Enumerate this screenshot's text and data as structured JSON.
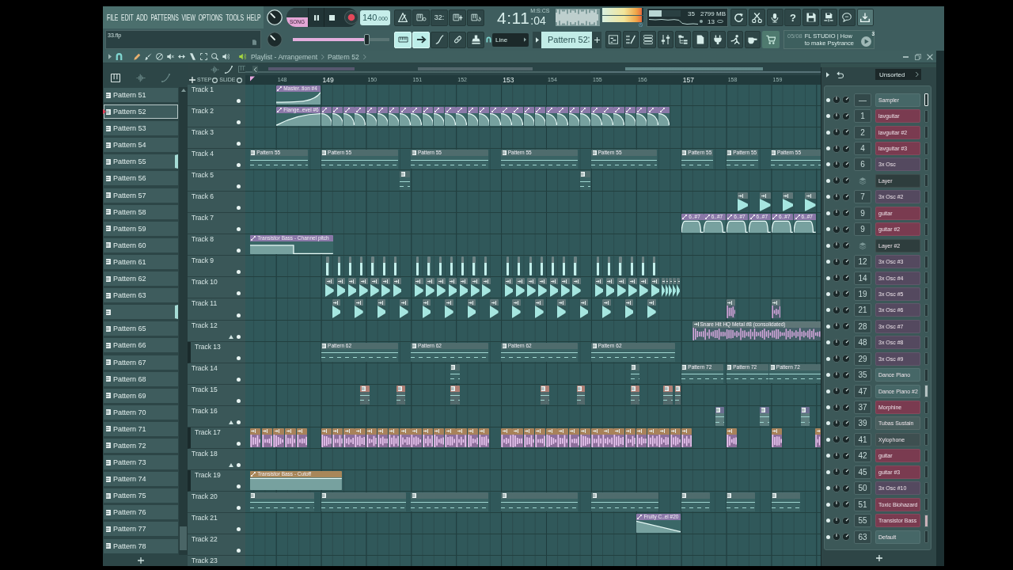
{
  "toolbar": {
    "menu": [
      "FILE",
      "EDIT",
      "ADD",
      "PATTERNS",
      "VIEW",
      "OPTIONS",
      "TOOLS",
      "HELP"
    ],
    "mode": {
      "label": "SONG",
      "selected": true
    },
    "tempo": "140",
    "tempo_decimals": ".000",
    "countdown_label": "32:",
    "time": "4:11",
    "time_hundredths": ":04",
    "time_format": "M:S:CS",
    "meters": [
      {
        "level": 0.97
      },
      {
        "level": 0.97
      }
    ],
    "cpu": {
      "level": 0.4,
      "reading": "35"
    },
    "memory": "2799 MB",
    "polyphony": "13",
    "help_label": "?",
    "hint": "33.flp",
    "song_position": {
      "level": 0.76
    },
    "record_toggles": [
      {
        "on": true
      },
      {
        "on": true
      },
      {
        "on": false
      },
      {
        "on": false
      },
      {
        "on": false
      }
    ],
    "snap": "Line",
    "pattern": "Pattern 52",
    "news": {
      "date": "05/08",
      "headline": "FL STUDIO | How to make Psytrance",
      "badge": "3"
    }
  },
  "playlist": {
    "title": "Playlist - Arrangement",
    "breadcrumb": "Pattern 52",
    "step_label": "STEP",
    "slide_label": "SLIDE",
    "patterns": [
      {
        "label": "Pattern 51",
        "selected": false,
        "marked": false
      },
      {
        "label": "Pattern 52",
        "selected": true,
        "marked": false
      },
      {
        "label": "Pattern 53",
        "selected": false,
        "marked": false
      },
      {
        "label": "Pattern 54",
        "selected": false,
        "marked": false
      },
      {
        "label": "Pattern 55",
        "selected": false,
        "marked": true
      },
      {
        "label": "Pattern 56",
        "selected": false,
        "marked": false
      },
      {
        "label": "Pattern 57",
        "selected": false,
        "marked": false
      },
      {
        "label": "Pattern 58",
        "selected": false,
        "marked": false
      },
      {
        "label": "Pattern 59",
        "selected": false,
        "marked": false
      },
      {
        "label": "Pattern 60",
        "selected": false,
        "marked": false
      },
      {
        "label": "Pattern 61",
        "selected": false,
        "marked": false
      },
      {
        "label": "Pattern 62",
        "selected": false,
        "marked": false
      },
      {
        "label": "Pattern 63",
        "selected": false,
        "marked": false
      },
      {
        "selected": false,
        "marked": true
      },
      {
        "label": "Pattern 65",
        "selected": false,
        "marked": false
      },
      {
        "label": "Pattern 66",
        "selected": false,
        "marked": false
      },
      {
        "label": "Pattern 67",
        "selected": false,
        "marked": false
      },
      {
        "label": "Pattern 68",
        "selected": false,
        "marked": false
      },
      {
        "label": "Pattern 69",
        "selected": false,
        "marked": false
      },
      {
        "label": "Pattern 70",
        "selected": false,
        "marked": false
      },
      {
        "label": "Pattern 71",
        "selected": false,
        "marked": false
      },
      {
        "label": "Pattern 72",
        "selected": false,
        "marked": false
      },
      {
        "label": "Pattern 73",
        "selected": false,
        "marked": false
      },
      {
        "label": "Pattern 74",
        "selected": false,
        "marked": false
      },
      {
        "label": "Pattern 75",
        "selected": false,
        "marked": false
      },
      {
        "label": "Pattern 76",
        "selected": false,
        "marked": false
      },
      {
        "label": "Pattern 77",
        "selected": false,
        "marked": false
      },
      {
        "label": "Pattern 78",
        "selected": false,
        "marked": false
      }
    ],
    "ruler": [
      "148",
      "149",
      "150",
      "151",
      "152",
      "153",
      "154",
      "155",
      "156",
      "157",
      "158",
      "159"
    ],
    "tracks": [
      {
        "name": "Track 1",
        "clips": [
          {
            "kind": "automation",
            "label": "Master..tion #4",
            "color": "#8a78a8"
          }
        ]
      },
      {
        "name": "Track 2",
        "clips": [
          {
            "kind": "automation",
            "label": "Flange..evel #6",
            "color": "#8a78a8"
          }
        ]
      },
      {
        "name": "Track 3"
      },
      {
        "name": "Track 4",
        "clips": [
          {
            "kind": "pattern",
            "label": "Pattern 55",
            "color": "#4f6c6d"
          },
          {
            "kind": "pattern",
            "label": "Pattern 55",
            "color": "#4f6c6d"
          },
          {
            "kind": "pattern",
            "label": "Pattern 55",
            "color": "#4f6c6d"
          },
          {
            "kind": "pattern",
            "label": "Pattern 55",
            "color": "#4f6c6d"
          },
          {
            "kind": "pattern",
            "label": "Pattern 55",
            "color": "#4f6c6d"
          },
          {
            "kind": "pattern",
            "label": "Pattern 55",
            "color": "#4f6c6d"
          },
          {
            "kind": "pattern",
            "label": "Pattern 55",
            "color": "#4f6c6d"
          },
          {
            "kind": "pattern",
            "label": "Pattern 55",
            "color": "#4f6c6d"
          }
        ]
      },
      {
        "name": "Track 5"
      },
      {
        "name": "Track 6"
      },
      {
        "name": "Track 7",
        "clips": [
          {
            "kind": "automation",
            "label": "6..#7",
            "color": "#8a78a8"
          },
          {
            "kind": "automation",
            "label": "6..#7",
            "color": "#8a78a8"
          },
          {
            "kind": "automation",
            "label": "6..#7",
            "color": "#8a78a8"
          },
          {
            "kind": "automation",
            "label": "6..#7",
            "color": "#8a78a8"
          },
          {
            "kind": "automation",
            "label": "6..#7",
            "color": "#8a78a8"
          },
          {
            "kind": "automation",
            "label": "6..#7",
            "color": "#8a78a8"
          }
        ]
      },
      {
        "name": "Track 8",
        "clips": [
          {
            "kind": "automation",
            "label": "Transistor Bass - Channel pitch",
            "color": "#8a78a8"
          }
        ]
      },
      {
        "name": "Track 9"
      },
      {
        "name": "Track 10"
      },
      {
        "name": "Track 11"
      },
      {
        "name": "Track 12",
        "expanded": true,
        "clips": [
          {
            "kind": "audio",
            "label": "Snare Hit HQ Metal #8 (consolidated)",
            "color": "#5f7677"
          }
        ],
        "children": [
          {
            "name": "Track 13",
            "clips": [
              {
                "kind": "pattern",
                "label": "Pattern 62",
                "color": "#4f6c6d"
              },
              {
                "kind": "pattern",
                "label": "Pattern 62",
                "color": "#4f6c6d"
              },
              {
                "kind": "pattern",
                "label": "Pattern 62",
                "color": "#4f6c6d"
              },
              {
                "kind": "pattern",
                "label": "Pattern 62",
                "color": "#4f6c6d"
              }
            ]
          }
        ]
      },
      {
        "name": "Track 14",
        "clips": [
          {
            "kind": "pattern",
            "label": "Pattern 72",
            "color": "#4f6c6d"
          },
          {
            "kind": "pattern",
            "label": "Pattern 72",
            "color": "#4f6c6d"
          },
          {
            "kind": "pattern",
            "label": "Pattern 72",
            "color": "#4f6c6d"
          }
        ]
      },
      {
        "name": "Track 15"
      },
      {
        "name": "Track 16",
        "expanded": true,
        "children": [
          {
            "name": "Track 17"
          }
        ]
      },
      {
        "name": "Track 18",
        "expanded": true,
        "children": [
          {
            "name": "Track 19",
            "clips": [
              {
                "kind": "automation",
                "label": "Transistor Bass - Cutoff",
                "color": "#a8875a"
              }
            ]
          }
        ]
      },
      {
        "name": "Track 20"
      },
      {
        "name": "Track 21",
        "clips": [
          {
            "kind": "automation",
            "label": "Fruity C..el #20",
            "color": "#8a78a8"
          }
        ]
      },
      {
        "name": "Track 22"
      },
      {
        "name": "Track 23"
      }
    ]
  },
  "channel_rack": {
    "filter": "Unsorted",
    "channels": [
      {
        "kind": "channel",
        "mixer": "—",
        "name": "Sampler",
        "color": "#466767",
        "selected": false,
        "focused": true
      },
      {
        "kind": "channel",
        "mixer": "1",
        "name": "lavguitar",
        "color": "#7a3b50",
        "selected": false,
        "focused": false
      },
      {
        "kind": "channel",
        "mixer": "2",
        "name": "lavguitar #2",
        "color": "#7a3b50",
        "selected": false,
        "focused": false
      },
      {
        "kind": "channel",
        "mixer": "4",
        "name": "lavguitar #3",
        "color": "#7a3b50",
        "selected": false,
        "focused": false
      },
      {
        "kind": "channel",
        "mixer": "6",
        "name": "3x Osc",
        "color": "#54495f",
        "selected": false,
        "focused": false
      },
      {
        "kind": "layer",
        "name": "Layer",
        "color": "#2e3d3d",
        "selected": false,
        "focused": false
      },
      {
        "kind": "channel",
        "mixer": "7",
        "name": "3x Osc #2",
        "color": "#54495f",
        "selected": false,
        "focused": false
      },
      {
        "kind": "channel",
        "mixer": "9",
        "name": "guitar",
        "color": "#7a3b50",
        "selected": false,
        "focused": false
      },
      {
        "kind": "channel",
        "mixer": "9",
        "name": "guitar #2",
        "color": "#7a3b50",
        "selected": false,
        "focused": false
      },
      {
        "kind": "layer",
        "name": "Layer #2",
        "color": "#2e3d3d",
        "selected": false,
        "focused": false
      },
      {
        "kind": "channel",
        "mixer": "12",
        "name": "3x Osc #3",
        "color": "#54495f",
        "selected": false,
        "focused": false
      },
      {
        "kind": "channel",
        "mixer": "14",
        "name": "3x Osc #4",
        "color": "#54495f",
        "selected": false,
        "focused": false
      },
      {
        "kind": "channel",
        "mixer": "19",
        "name": "3x Osc #5",
        "color": "#54495f",
        "selected": false,
        "focused": false
      },
      {
        "kind": "channel",
        "mixer": "21",
        "name": "3x Osc #6",
        "color": "#54495f",
        "selected": false,
        "focused": false
      },
      {
        "kind": "channel",
        "mixer": "28",
        "name": "3x Osc #7",
        "color": "#54495f",
        "selected": false,
        "focused": false
      },
      {
        "kind": "channel",
        "mixer": "48",
        "name": "3x Osc #8",
        "color": "#54495f",
        "selected": false,
        "focused": false
      },
      {
        "kind": "channel",
        "mixer": "29",
        "name": "3x Osc #9",
        "color": "#54495f",
        "selected": false,
        "focused": false
      },
      {
        "kind": "channel",
        "mixer": "35",
        "name": "Dance Piano",
        "color": "#466767",
        "selected": false,
        "focused": false
      },
      {
        "kind": "channel",
        "mixer": "47",
        "name": "Dance Piano #2",
        "color": "#466767",
        "selected": true,
        "focused": false
      },
      {
        "kind": "channel",
        "mixer": "37",
        "name": "Morphine",
        "color": "#7a3b50",
        "selected": false,
        "focused": false
      },
      {
        "kind": "channel",
        "mixer": "39",
        "name": "Tubas Sustain",
        "color": "#4a5e5e",
        "selected": false,
        "focused": false
      },
      {
        "kind": "channel",
        "mixer": "41",
        "name": "Xylophone",
        "color": "#3e4f50",
        "selected": false,
        "focused": false
      },
      {
        "kind": "channel",
        "mixer": "42",
        "name": "guitar",
        "color": "#7a3b50",
        "selected": false,
        "focused": false
      },
      {
        "kind": "channel",
        "mixer": "45",
        "name": "guitar #3",
        "color": "#7a3b50",
        "selected": false,
        "focused": false
      },
      {
        "kind": "channel",
        "mixer": "50",
        "name": "3x Osc #10",
        "color": "#54495f",
        "selected": false,
        "focused": false
      },
      {
        "kind": "channel",
        "mixer": "51",
        "name": "Toxic Biohazard",
        "color": "#7a3b50",
        "selected": false,
        "focused": false
      },
      {
        "kind": "channel",
        "mixer": "55",
        "name": "Transistor Bass",
        "color": "#7a3b50",
        "selected": true,
        "focused": false
      },
      {
        "kind": "channel",
        "mixer": "63",
        "name": "Default",
        "color": "#466767",
        "selected": false,
        "focused": false
      }
    ]
  }
}
